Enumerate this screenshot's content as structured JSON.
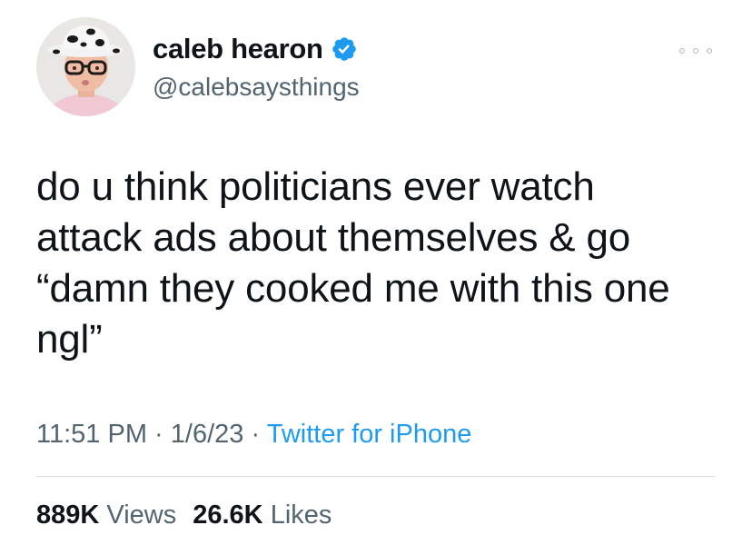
{
  "author": {
    "display_name": "caleb hearon",
    "handle": "@calebsaysthings",
    "verified": true,
    "avatar_icon": "profile-photo"
  },
  "tweet": {
    "text": "do u think politicians ever watch\nattack ads about themselves & go\n“damn they cooked me with this one\nngl”"
  },
  "meta": {
    "time": "11:51 PM",
    "separator": "·",
    "date": "1/6/23",
    "source": "Twitter for iPhone"
  },
  "stats": {
    "views_count": "889K",
    "views_label": "Views",
    "likes_count": "26.6K",
    "likes_label": "Likes"
  },
  "colors": {
    "text_primary": "#0f1419",
    "text_secondary": "#536471",
    "accent": "#1d9bf0",
    "divider": "#d9dee2"
  },
  "icons": {
    "verified": "verified-badge-icon",
    "more": "more-options-icon"
  }
}
